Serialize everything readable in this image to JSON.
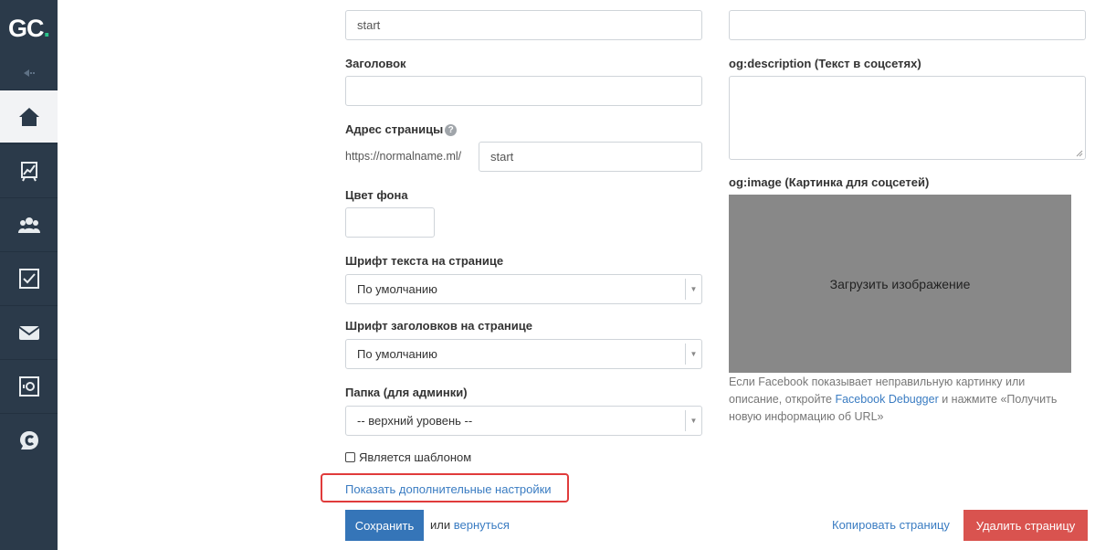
{
  "sidebar": {
    "logo_main": "GC",
    "logo_dot": ".",
    "items": [
      {
        "icon": "home-icon"
      },
      {
        "icon": "chart-icon"
      },
      {
        "icon": "users-icon"
      },
      {
        "icon": "checkbox-icon"
      },
      {
        "icon": "mail-icon"
      },
      {
        "icon": "safe-icon"
      },
      {
        "icon": "chat-icon"
      }
    ]
  },
  "form": {
    "admin_name_value": "start",
    "title_label": "Заголовок",
    "title_value": "",
    "address_label": "Адрес страницы",
    "address_prefix": "https://normalname.ml/",
    "address_value": "start",
    "bg_color_label": "Цвет фона",
    "bg_color_value": "",
    "text_font_label": "Шрифт текста на странице",
    "text_font_value": "По умолчанию",
    "heading_font_label": "Шрифт заголовков на странице",
    "heading_font_value": "По умолчанию",
    "folder_label": "Папка (для админки)",
    "folder_value": "-- верхний уровень --",
    "template_checkbox_label": "Является шаблоном",
    "advanced_link": "Показать дополнительные настройки"
  },
  "social": {
    "og_title_value": "",
    "og_description_label": "og:description (Текст в соцсетях)",
    "og_image_label": "og:image (Картинка для соцсетей)",
    "upload_label": "Загрузить изображение",
    "note_part1": "Если Facebook показывает неправильную картинку или описание, откройте ",
    "note_link": "Facebook Debugger",
    "note_part2": " и нажмите «Получить новую информацию об URL»"
  },
  "actions": {
    "save_label": "Сохранить",
    "or_label": "или",
    "back_label": "вернуться",
    "copy_label": "Копировать страницу",
    "delete_label": "Удалить страницу"
  },
  "colors": {
    "sidebar_bg": "#2b3a4a",
    "accent": "#2bc48a",
    "primary": "#3575b8",
    "danger": "#d9534f",
    "highlight": "#e03b3b"
  }
}
